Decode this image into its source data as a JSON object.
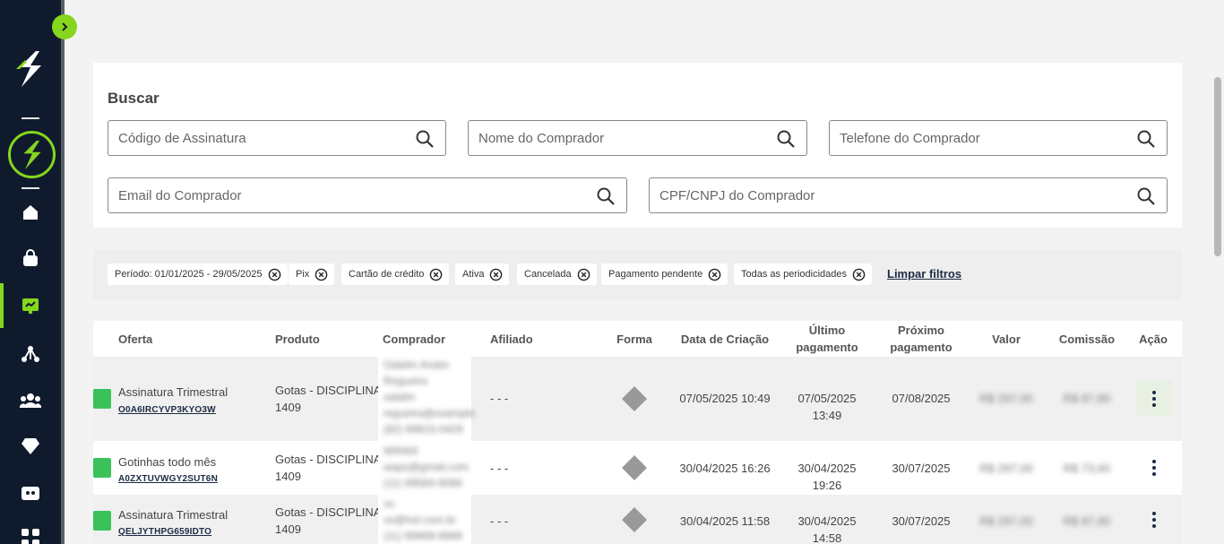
{
  "sidebar": {
    "toggle_icon": "chevron-right-icon",
    "brand_color": "#86d61e",
    "items": [
      {
        "name": "home",
        "icon": "home-icon"
      },
      {
        "name": "products",
        "icon": "bag-icon"
      },
      {
        "name": "subscriptions",
        "icon": "subscription-icon",
        "active": true
      },
      {
        "name": "affiliates",
        "icon": "network-icon"
      },
      {
        "name": "members",
        "icon": "users-icon"
      },
      {
        "name": "rewards",
        "icon": "diamond-icon"
      },
      {
        "name": "cards",
        "icon": "card-icon"
      },
      {
        "name": "apps",
        "icon": "apps-icon"
      }
    ]
  },
  "search": {
    "title": "Buscar",
    "fields": {
      "subscription_code": "Código de Assinatura",
      "buyer_name": "Nome do Comprador",
      "buyer_phone": "Telefone do Comprador",
      "buyer_email": "Email do Comprador",
      "buyer_document": "CPF/CNPJ do Comprador"
    }
  },
  "filters": {
    "chips": [
      "Período: 01/01/2025 - 29/05/2025",
      "Pix",
      "Cartão de crédito",
      "Ativa",
      "Cancelada",
      "Pagamento pendente",
      "Todas as periodicidades"
    ],
    "clear_label": "Limpar filtros"
  },
  "table": {
    "headers": {
      "offer": "Oferta",
      "product": "Produto",
      "buyer": "Comprador",
      "affiliate": "Afiliado",
      "method": "Forma",
      "created": "Data de Criação",
      "last_payment": "Último pagamento",
      "next_payment": "Próximo pagamento",
      "value": "Valor",
      "commission": "Comissão",
      "action": "Ação"
    },
    "status_color": "#3ac25a",
    "rows": [
      {
        "offer": "Assinatura Trimestral",
        "code": "O0A6IRCYVP3KYO3W",
        "product_line1": "Gotas - DISCIPLINA",
        "product_line2": "1409",
        "buyer_line1": "Odailm Andre",
        "buyer_line2": "Regueira",
        "buyer_line3": "odailm",
        "buyer_line4": "regueira@example",
        "buyer_line5": "(82) 99815-0429",
        "affiliate": "- - -",
        "method_icon": "pix-icon",
        "created": "07/05/2025 10:49",
        "last_payment": "07/05/2025 13:49",
        "next_payment": "07/08/2025",
        "value": "R$ 297,00",
        "commission": "R$ 87,80"
      },
      {
        "offer": "Gotinhas todo mês",
        "code": "A0ZXTUVWGY2SUT6N",
        "product_line1": "Gotas - DISCIPLINA",
        "product_line2": "1409",
        "buyer_line1": "WANIA",
        "buyer_line2": "waps@gmail.com",
        "buyer_line3": "(11) 99584-9066",
        "affiliate": "- - -",
        "method_icon": "pix-icon",
        "created": "30/04/2025 16:26",
        "last_payment": "30/04/2025 19:26",
        "next_payment": "30/07/2025",
        "value": "R$ 297,00",
        "commission": "R$ 73,60"
      },
      {
        "offer": "Assinatura Trimestral",
        "code": "QELJYTHPG659IDTO",
        "product_line1": "Gotas - DISCIPLINA",
        "product_line2": "1409",
        "buyer_line1": "vs",
        "buyer_line2": "vs@hot.com.br",
        "buyer_line3": "(11) 99999-9999",
        "affiliate": "- - -",
        "method_icon": "pix-icon",
        "created": "30/04/2025 11:58",
        "last_payment": "30/04/2025 14:58",
        "next_payment": "30/07/2025",
        "value": "R$ 297,00",
        "commission": "R$ 87,80"
      }
    ]
  }
}
